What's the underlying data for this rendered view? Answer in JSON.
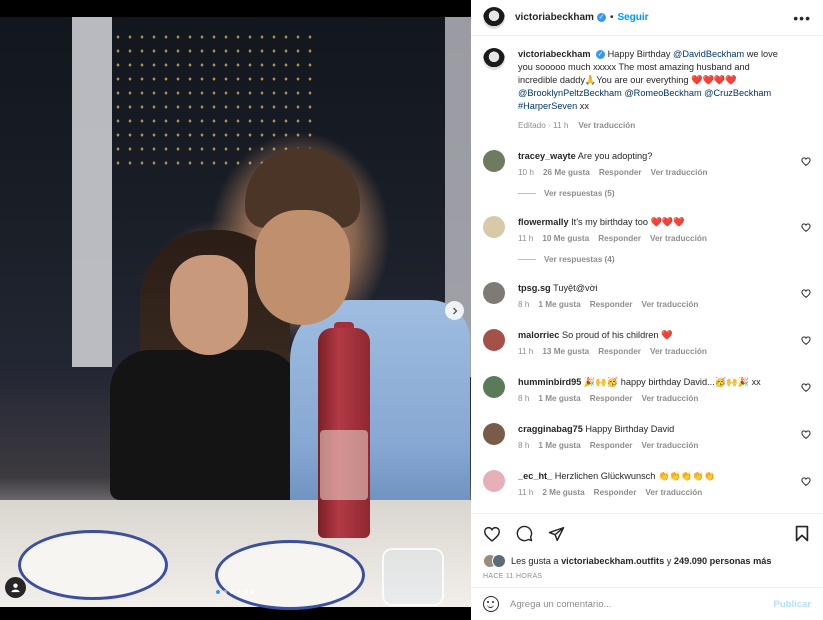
{
  "post": {
    "username": "victoriabeckham",
    "follow_label": "Seguir",
    "separator": "•",
    "more_label": "•••"
  },
  "caption": {
    "username": "victoriabeckham",
    "text_1": "Happy Birthday ",
    "mention_1": "@DavidBeckham",
    "text_2": " we love you sooooo much xxxxx The most amazing husband and incredible daddy🙏You are our everything ❤️❤️❤️❤️ ",
    "mention_2": "@BrooklynPeltzBeckham",
    "mention_3": "@RomeoBeckham",
    "mention_4": "@CruzBeckham",
    "mention_5": "#HarperSeven",
    "text_3": " xx",
    "edited": "Editado · 11 h",
    "translate": "Ver traducción"
  },
  "comments": [
    {
      "user": "tracey_wayte",
      "text": "Are you adopting?",
      "time": "10 h",
      "likes": "26 Me gusta",
      "reply": "Responder",
      "translate": "Ver traducción",
      "replies": "Ver respuestas (5)"
    },
    {
      "user": "flowermally",
      "text": "It's my birthday too ❤️❤️❤️",
      "time": "11 h",
      "likes": "10 Me gusta",
      "reply": "Responder",
      "translate": "Ver traducción",
      "replies": "Ver respuestas (4)"
    },
    {
      "user": "tpsg.sg",
      "text": "Tuyệt@vời",
      "time": "8 h",
      "likes": "1 Me gusta",
      "reply": "Responder",
      "translate": "Ver traducción"
    },
    {
      "user": "malorriec",
      "text": "So proud of his children ❤️",
      "time": "11 h",
      "likes": "13 Me gusta",
      "reply": "Responder",
      "translate": "Ver traducción"
    },
    {
      "user": "humminbird95",
      "text": "🎉🙌🥳 happy birthday David...🥳🙌🎉 xx",
      "time": "8 h",
      "likes": "1 Me gusta",
      "reply": "Responder",
      "translate": "Ver traducción"
    },
    {
      "user": "cragginabag75",
      "text": "Happy Birthday David",
      "time": "8 h",
      "likes": "1 Me gusta",
      "reply": "Responder",
      "translate": "Ver traducción"
    },
    {
      "user": "_ec_ht_",
      "text": "Herzlichen Glückwunsch 👏👏👏👏👏",
      "time": "11 h",
      "likes": "2 Me gusta",
      "reply": "Responder",
      "translate": "Ver traducción"
    }
  ],
  "likes": {
    "prefix": "Les gusta a ",
    "user": "victoriabeckham.outfits",
    "middle": " y ",
    "count": "249.090 personas más"
  },
  "time_ago": "HACE 11 HORAS",
  "add_comment": {
    "placeholder": "Agrega un comentario...",
    "publish_label": "Publicar"
  },
  "carousel": {
    "count": 6,
    "active_index": 0
  },
  "colors": {
    "link_blue": "#0095f6",
    "mention_blue": "#00376b",
    "muted": "#8e8e8e",
    "active_dot": "#3897f0"
  },
  "icons": {
    "like": "heart-icon",
    "comment": "comment-icon",
    "share": "share-icon",
    "save": "bookmark-icon",
    "emoji": "emoji-icon",
    "verified": "verified-badge-icon",
    "next": "chevron-right-icon",
    "tag": "user-tag-icon"
  }
}
